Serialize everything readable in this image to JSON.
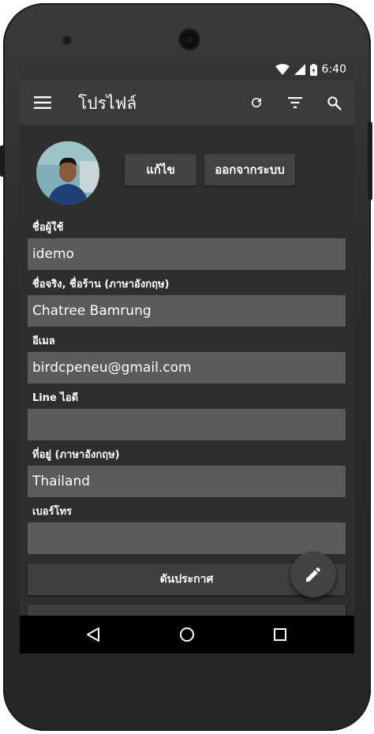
{
  "status_bar": {
    "time": "6:40",
    "icons": [
      "wifi-icon",
      "signal-icon",
      "battery-charging-icon"
    ]
  },
  "app_bar": {
    "title": "โปรไฟล์",
    "menu_icon": "menu-icon",
    "actions": [
      "refresh-icon",
      "filter-icon",
      "search-icon"
    ]
  },
  "profile": {
    "avatar_icon": "avatar",
    "edit_label": "แก้ไข",
    "logout_label": "ออกจากระบบ"
  },
  "form": {
    "username_label": "ชื่อผู้ใช้",
    "username_value": "idemo",
    "realname_label": "ชื่อจริง, ชื่อร้าน (ภาษาอังกฤษ)",
    "realname_value": "Chatree Bamrung",
    "email_label": "อีเมล",
    "email_value": "birdcpeneu@gmail.com",
    "line_label": "Line ไอดี",
    "line_value": "",
    "address_label": "ที่อยู่ (ภาษาอังกฤษ)",
    "address_value": "Thailand",
    "phone_label": "เบอร์โทร",
    "phone_value": ""
  },
  "actions": {
    "post_label": "ดันประกาศ"
  },
  "fab": {
    "icon": "pencil-icon"
  },
  "nav_bar": {
    "icons": [
      "back-icon",
      "home-icon",
      "recents-icon"
    ]
  },
  "colors": {
    "screen_bg": "#2e2e2e",
    "appbar": "#3b3b3b",
    "field": "#5b5b5b",
    "button": "#424242"
  }
}
